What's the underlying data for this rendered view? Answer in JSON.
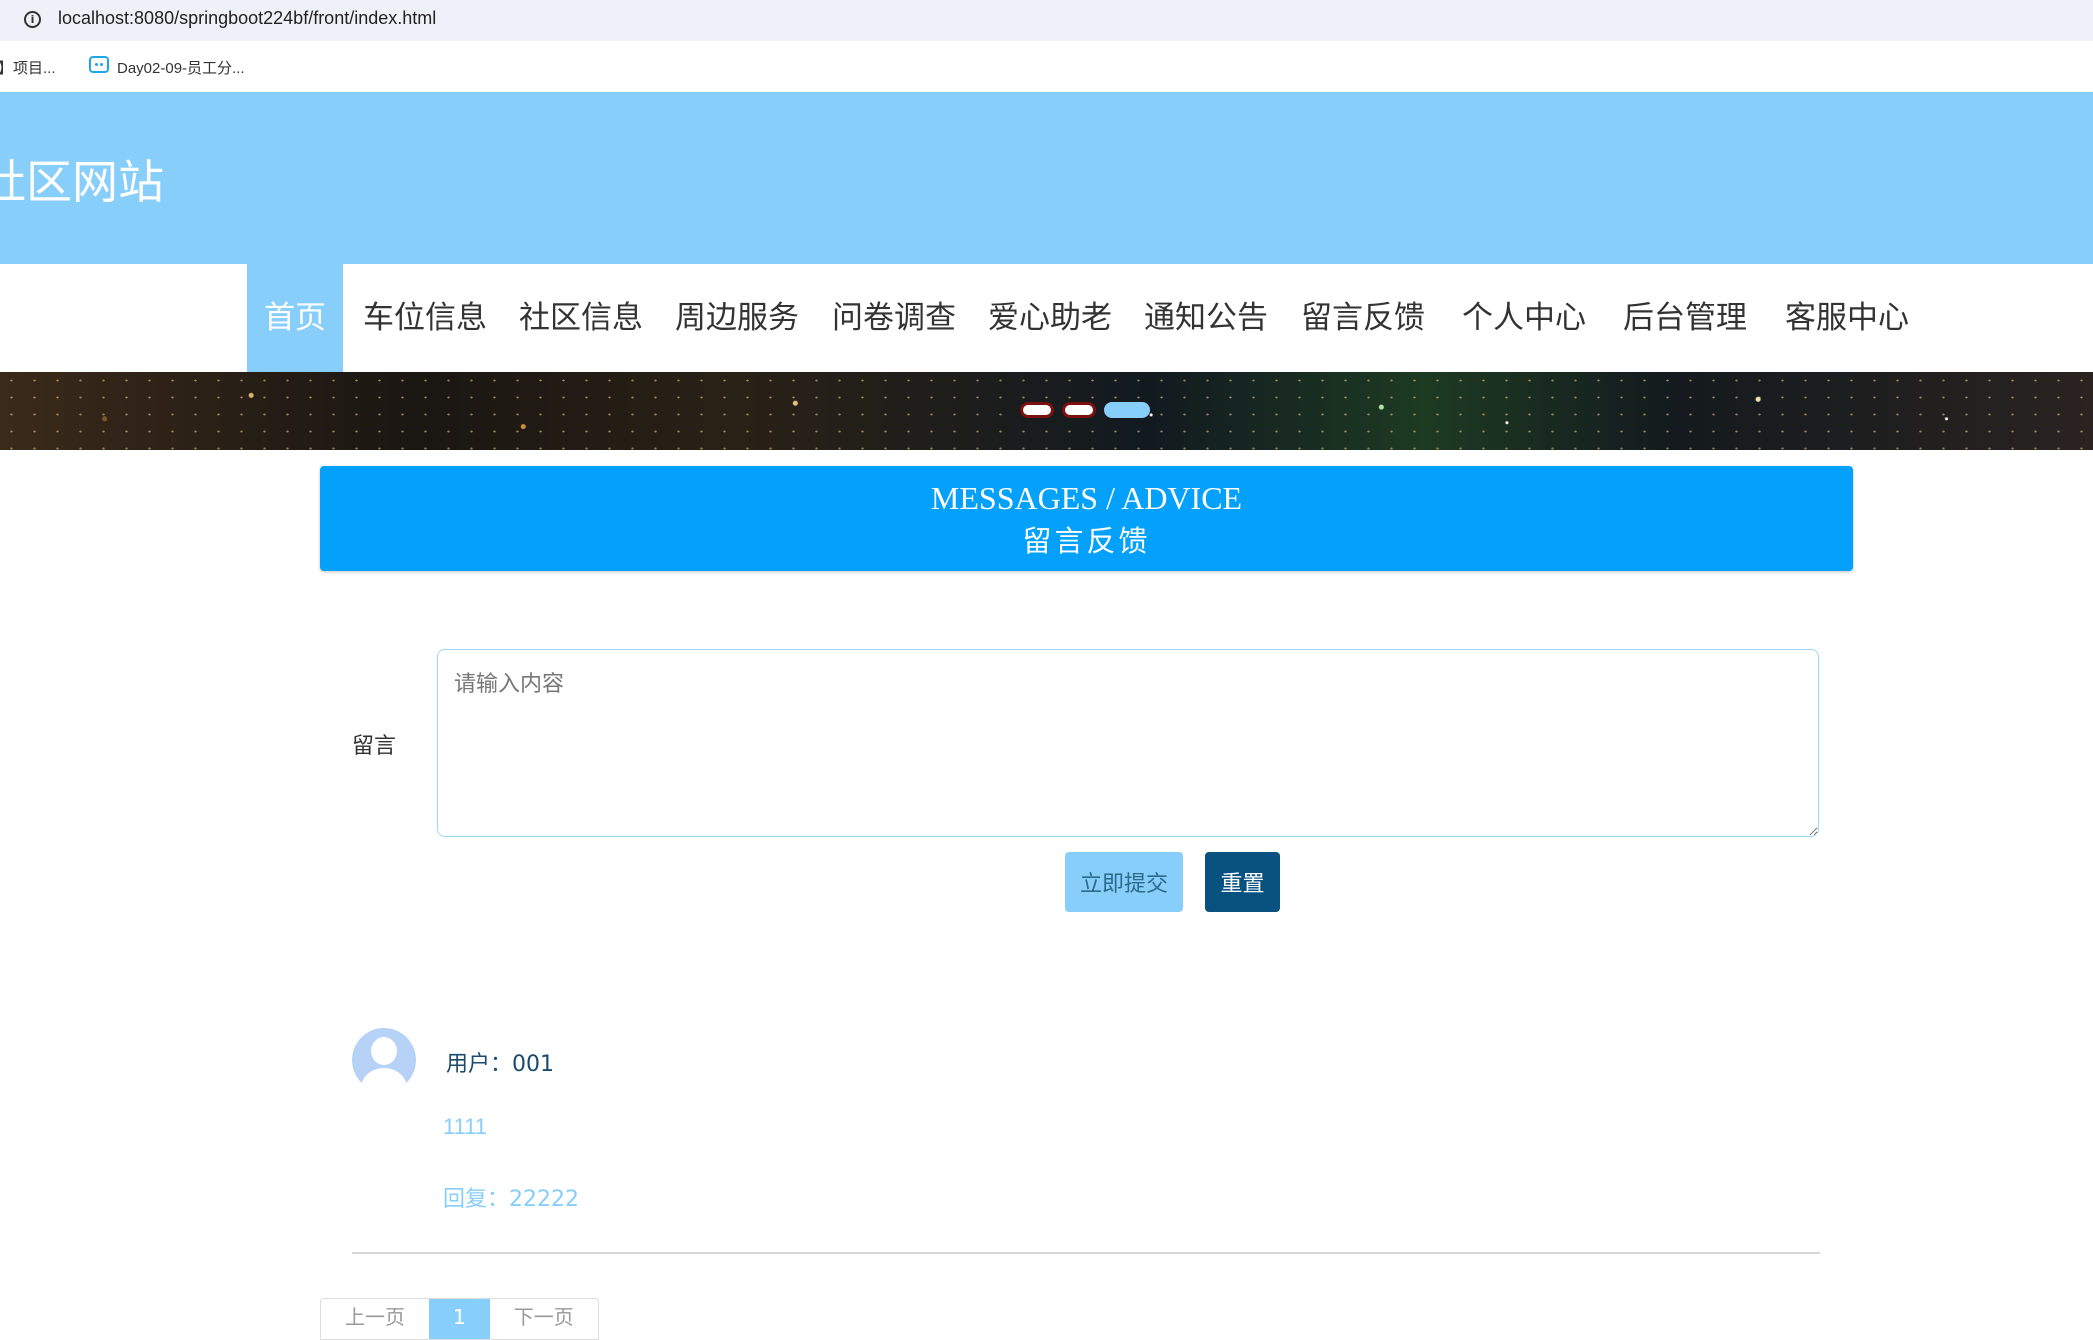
{
  "browser": {
    "url": "localhost:8080/springboot224bf/front/index.html",
    "bookmarks": [
      "】项目...",
      "Day02-09-员工分..."
    ]
  },
  "site": {
    "title": "社区网站"
  },
  "nav": {
    "items": [
      "首页",
      "车位信息",
      "社区信息",
      "周边服务",
      "问卷调查",
      "爱心助老",
      "通知公告",
      "留言反馈",
      "个人中心",
      "后台管理",
      "客服中心"
    ],
    "active_index": 0
  },
  "banner": {
    "slide_count": 3,
    "active_slide": 2
  },
  "section": {
    "title_en": "MESSAGES / ADVICE",
    "title_cn": "留言反馈"
  },
  "form": {
    "label": "留言",
    "placeholder": "请输入内容",
    "value": "",
    "submit_label": "立即提交",
    "reset_label": "重置"
  },
  "messages": [
    {
      "user": "用户：001",
      "content": "1111",
      "reply": "回复：22222"
    }
  ],
  "pagination": {
    "prev_label": "上一页",
    "current_page": "1",
    "next_label": "下一页"
  },
  "colors": {
    "primary": "#87cefa",
    "section_head": "#03a1fc",
    "reset_button": "#09527f"
  }
}
